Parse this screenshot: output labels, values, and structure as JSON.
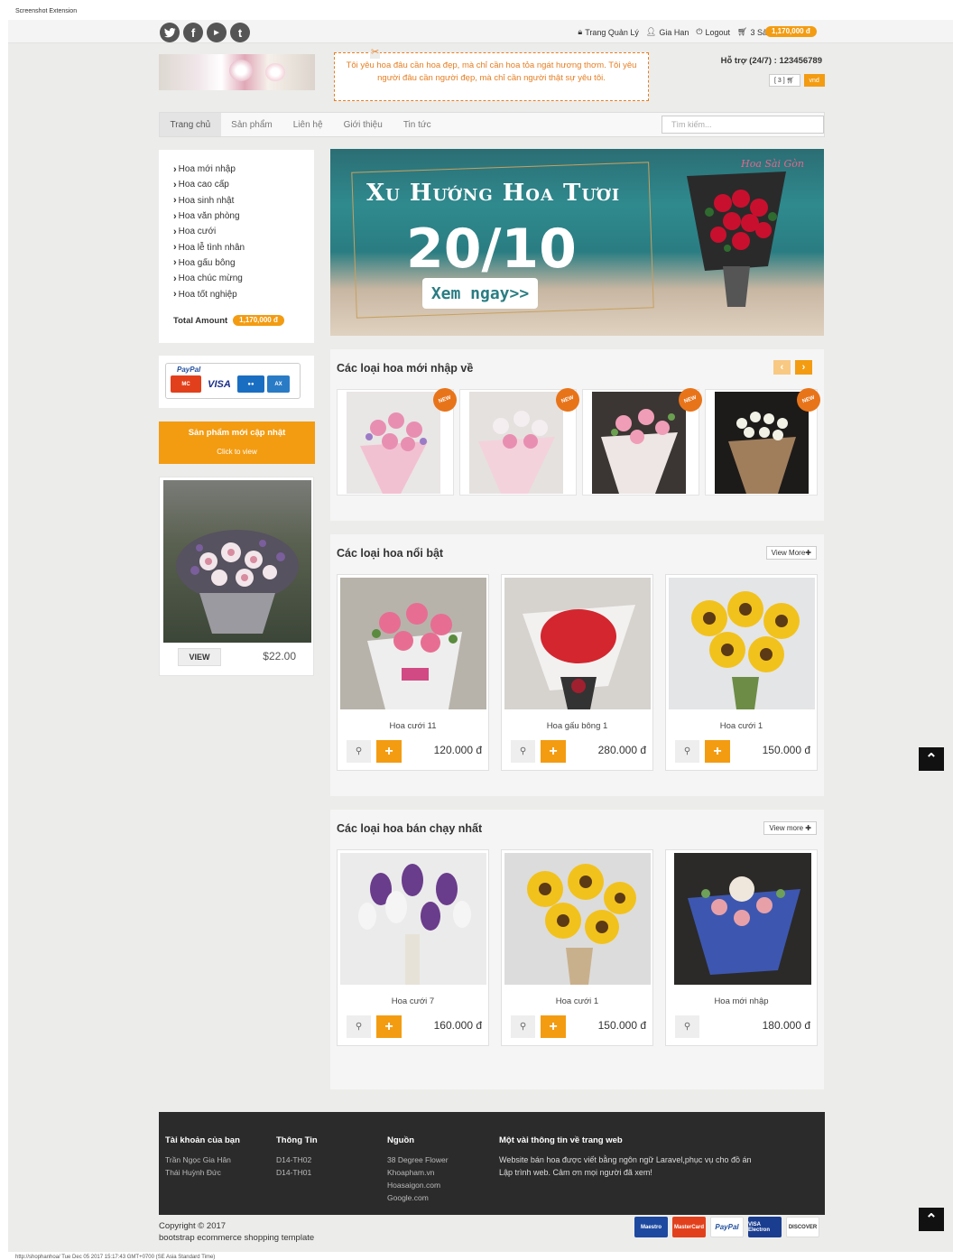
{
  "extension_label": "Screenshot Extension",
  "topbar": {
    "social": [
      "twitter-icon",
      "facebook-icon",
      "youtube-icon",
      "tumblr-icon"
    ],
    "admin_link": "Trang Quản Lý",
    "user_link": "Gia Han",
    "logout_link": "Logout",
    "cart_text": "3 Sản phẩm(s) -",
    "cart_total": "1,170,000 đ"
  },
  "header": {
    "quote": "Tôi yêu hoa đâu cần hoa đẹp, mà chỉ cần hoa tỏa ngát hương thơm. Tôi yêu người đâu cần người đẹp, mà chỉ cần người thật sự yêu tôi.",
    "support": "Hỗ trợ (24/7) : 123456789",
    "cart_button": "[ 3 ]",
    "currency_button": "vnd"
  },
  "nav": {
    "items": [
      "Trang chủ",
      "Sản phẩm",
      "Liên hệ",
      "Giới thiệu",
      "Tin tức"
    ],
    "search_placeholder": "Tìm kiếm..."
  },
  "sidebar": {
    "categories": [
      "Hoa mới nhập",
      "Hoa cao cấp",
      "Hoa sinh nhật",
      "Hoa văn phòng",
      "Hoa cưới",
      "Hoa lễ tình nhân",
      "Hoa gấu bông",
      "Hoa chúc mừng",
      "Hoa tốt nghiệp"
    ],
    "total_label": "Total Amount",
    "total_value": "1,170,000 đ",
    "paypal_label": "PayPal",
    "new_products_title": "Sản phẩm mới cập nhật",
    "new_products_sub": "Click to view",
    "featured_button": "VIEW",
    "featured_price": "$22.00"
  },
  "banner": {
    "heading": "Xu Hướng Hoa Tươi",
    "date": "20/10",
    "button": "Xem ngay>>",
    "signature": "Hoa Sài Gòn"
  },
  "new_arrivals": {
    "title": "Các loại hoa mới nhập về",
    "badge": "NEW"
  },
  "featured": {
    "title": "Các loại hoa nổi bật",
    "view_more": "View More",
    "products": [
      {
        "name": "Hoa cưới 11",
        "price": "120.000 đ"
      },
      {
        "name": "Hoa gấu bông 1",
        "price": "280.000 đ"
      },
      {
        "name": "Hoa cưới 1",
        "price": "150.000 đ"
      }
    ]
  },
  "bestsellers": {
    "title": "Các loại hoa bán chạy nhất",
    "view_more": "View more",
    "products": [
      {
        "name": "Hoa cưới 7",
        "price": "160.000 đ"
      },
      {
        "name": "Hoa cưới 1",
        "price": "150.000 đ"
      },
      {
        "name": "Hoa mới nhập",
        "price": "180.000 đ"
      }
    ]
  },
  "footer": {
    "col1": {
      "title": "Tài khoản của bạn",
      "lines": [
        "Trần Ngọc Gia Hân",
        "Thái Huỳnh Đức"
      ]
    },
    "col2": {
      "title": "Thông Tin",
      "lines": [
        "D14-TH02",
        "D14-TH01"
      ]
    },
    "col3": {
      "title": "Nguồn",
      "lines": [
        "38 Degree Flower",
        "Khoapham.vn",
        "Hoasaigon.com",
        "Google.com"
      ]
    },
    "col4": {
      "title": "Một vài thông tin về trang web",
      "lines": [
        "Website bán hoa được viết bằng ngôn ngữ Laravel,phục vụ cho đồ án",
        "Lập trình web. Cảm ơn mọi người đã xem!"
      ]
    },
    "copyright": "Copyright © 2017",
    "template": "bootstrap ecommerce shopping template",
    "payment_logos": [
      "Maestro",
      "MasterCard",
      "PayPal",
      "VISA Electron",
      "DISCOVER"
    ]
  },
  "status_url": "http://shophanhoa/ Tue Dec 05 2017 15:17:43 GMT+0700 (SE Asia Standard Time)"
}
